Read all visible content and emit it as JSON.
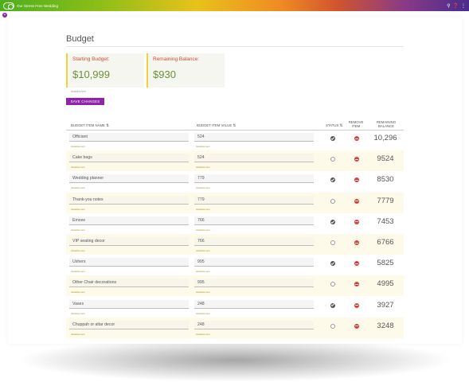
{
  "app": {
    "title": "Our Stress Free Wedding"
  },
  "page": {
    "title": "Budget"
  },
  "cards": {
    "starting": {
      "label": "Starting Budget:",
      "value": "$10,999"
    },
    "remaining": {
      "label": "Remaining Balance:",
      "value": "$930"
    }
  },
  "helper_text": "Assistive text",
  "actions": {
    "save": "SAVE CHANGES"
  },
  "table": {
    "headers": {
      "name": "BUDGET ITEM NAME ⇅",
      "value": "BUDGET ITEM VALUE ⇅",
      "status": "STATUS ⇅",
      "remove": "REMOVE ITEM",
      "remaining": "REMAINING BALANCE"
    },
    "rows": [
      {
        "name": "Officiant",
        "value": "524",
        "status": true,
        "remaining": "10,296"
      },
      {
        "name": "Cake bags",
        "value": "524",
        "status": false,
        "remaining": "9524"
      },
      {
        "name": "Wedding planner",
        "value": "779",
        "status": true,
        "remaining": "8530"
      },
      {
        "name": "Thank-you notes",
        "value": "779",
        "status": false,
        "remaining": "7779"
      },
      {
        "name": "Emcee",
        "value": "766",
        "status": true,
        "remaining": "7453"
      },
      {
        "name": "VIP seating decor",
        "value": "766",
        "status": false,
        "remaining": "6766"
      },
      {
        "name": "Ushers",
        "value": "995",
        "status": true,
        "remaining": "5825"
      },
      {
        "name": "Other Chair decorations",
        "value": "995",
        "status": false,
        "remaining": "4995"
      },
      {
        "name": "Vases",
        "value": "248",
        "status": true,
        "remaining": "3927"
      },
      {
        "name": "Chuppah or altar decor",
        "value": "248",
        "status": false,
        "remaining": "3248"
      }
    ]
  }
}
